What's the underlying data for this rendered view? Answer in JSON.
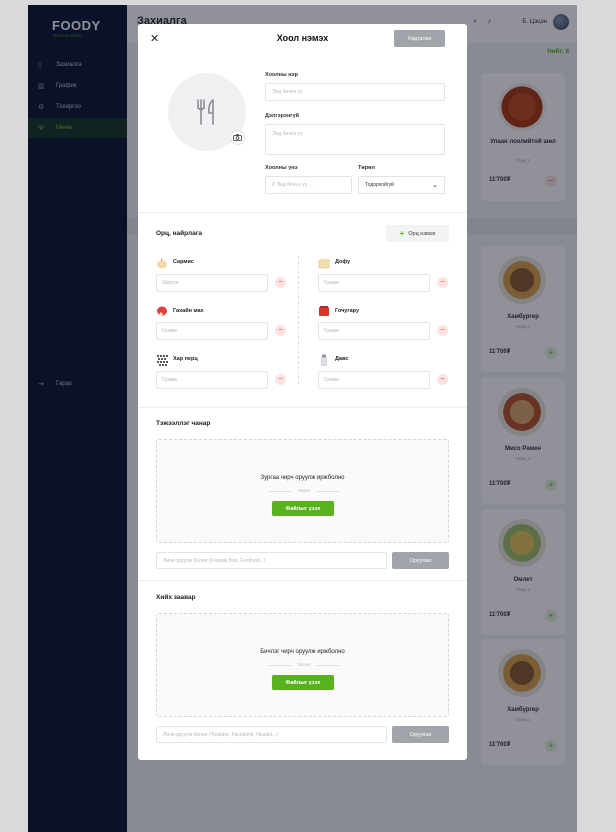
{
  "app": {
    "logo": "FOODY",
    "logo_tagline": "RESTAURANT",
    "page_title": "Захиалга",
    "user_name": "Б. Цэцэн",
    "total_label": "Нийт: 8"
  },
  "sidebar": {
    "items": [
      {
        "label": "Захиалга",
        "icon": "clipboard-icon"
      },
      {
        "label": "График",
        "icon": "chart-icon"
      },
      {
        "label": "Тохиргоо",
        "icon": "gear-icon"
      },
      {
        "label": "Меню",
        "icon": "fork-knife-icon",
        "active": true
      }
    ],
    "logout": "Гарах"
  },
  "menu_cards": [
    {
      "name": "Улаан лоолийтой шөл",
      "qty": "Порц 1",
      "price": "11'700₮",
      "action": "−"
    },
    {
      "name": "Хамбургер",
      "qty": "Порц 1",
      "price": "11'700₮",
      "action": "+"
    },
    {
      "name": "Мисо Рамен",
      "qty": "Порц 1",
      "price": "11'700₮",
      "action": "+"
    },
    {
      "name": "Омлет",
      "qty": "Порц 1",
      "price": "11'700₮",
      "action": "+"
    },
    {
      "name": "Хамбургер",
      "qty": "Порц 1",
      "price": "11'700₮",
      "action": "+"
    }
  ],
  "modal": {
    "title": "Хоол нэмэх",
    "save_label": "Хадгалах",
    "food_name": {
      "label": "Хоолны нэр",
      "placeholder": "Энд бичнэ үү"
    },
    "description": {
      "label": "Дэлгэрэнгүй",
      "placeholder": "Энд бичнэ үү"
    },
    "price": {
      "label": "Хоолны үнэ",
      "placeholder": "₮ Энд бичнэ үү ..."
    },
    "type": {
      "label": "Төрөл",
      "value": "Тодорхойгүй"
    },
    "ingredients": {
      "title": "Орц, найрлага",
      "add_label": "Орц нэмэх",
      "items": [
        {
          "name": "Сармис",
          "placeholder": "Ширхэг",
          "icon": "garlic-icon"
        },
        {
          "name": "Дофу",
          "placeholder": "Грамм",
          "icon": "tofu-icon"
        },
        {
          "name": "Гахайн мах",
          "placeholder": "Грамм",
          "icon": "meat-icon"
        },
        {
          "name": "Гочугару",
          "placeholder": "Грамм",
          "icon": "chili-icon"
        },
        {
          "name": "Хар перц",
          "placeholder": "Грамм",
          "icon": "pepper-icon"
        },
        {
          "name": "Давс",
          "placeholder": "Грамм",
          "icon": "salt-icon"
        }
      ]
    },
    "quality": {
      "title": "Тэжээллэг чанар",
      "drop_text": "Зургаа чирч оруулж иржболно",
      "or_text": "Эсвэл",
      "choose_label": "Файлыг үзэх",
      "link_placeholder": "Линк оруулж болно (Freepik,Bon, Fastfood...)",
      "insert_label": "Оруулах"
    },
    "recipe": {
      "title": "Хийх заавар",
      "drop_text": "Бичлэг чирч оруулж иржболно",
      "or_text": "Эсвэл",
      "choose_label": "Файлыг үзэх",
      "link_placeholder": "Линк оруулж болно (Youtube, Facebook, Nuudel...)",
      "insert_label": "Оруулах"
    }
  }
}
